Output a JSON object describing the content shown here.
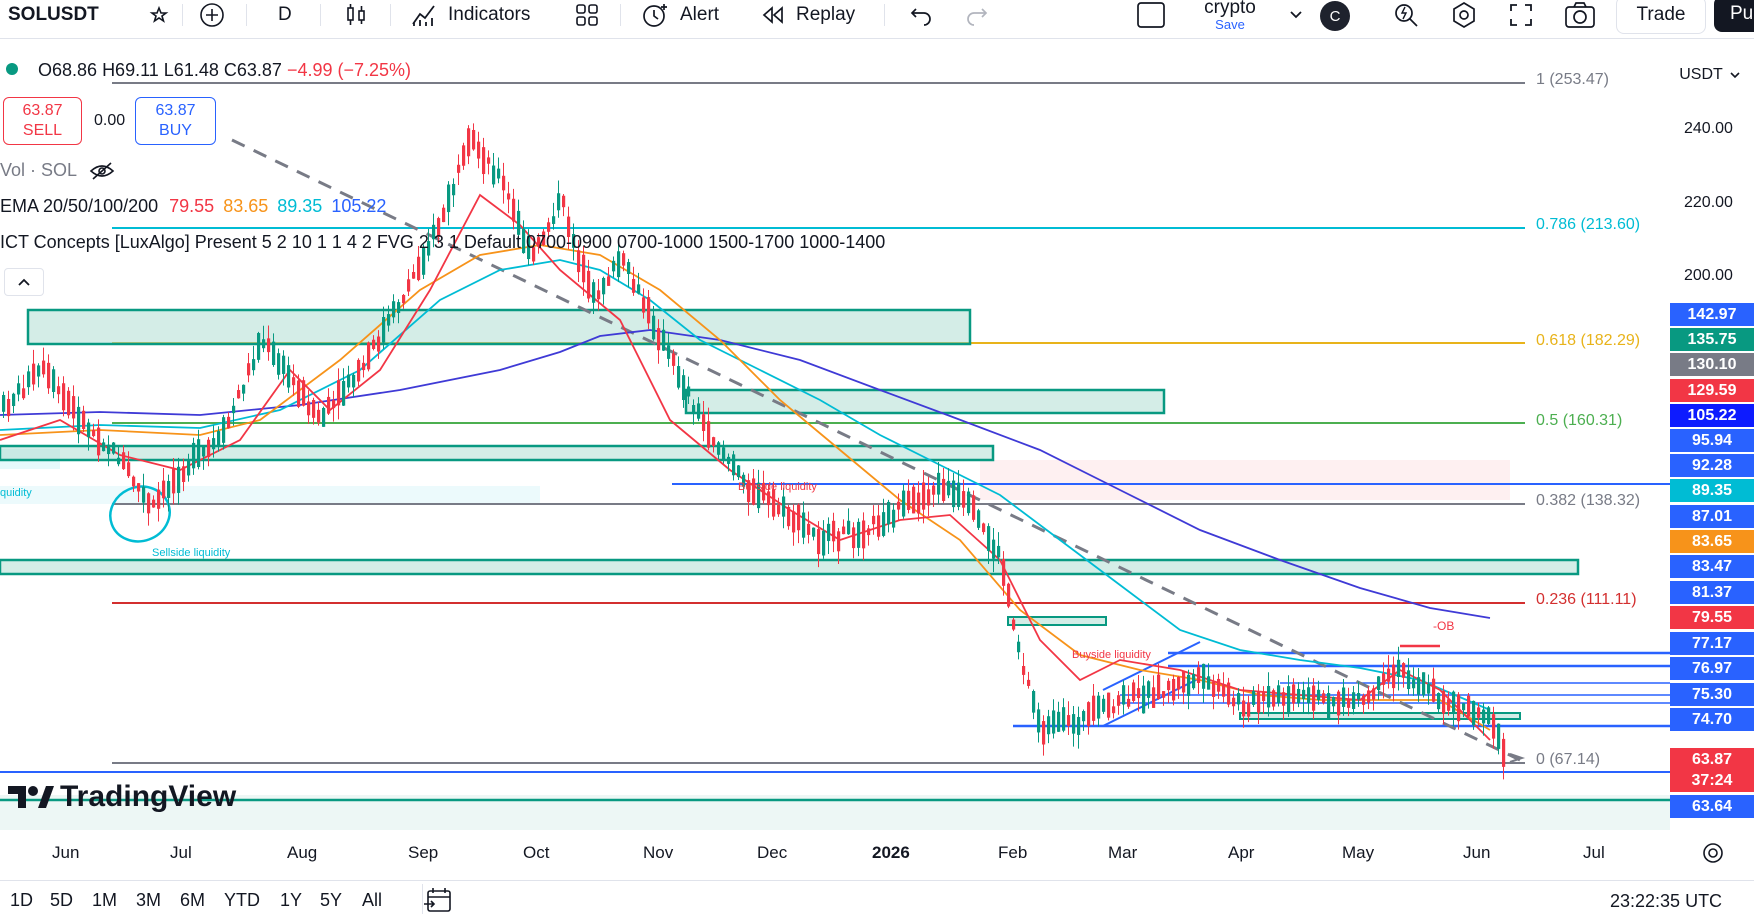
{
  "toolbar": {
    "symbol": "SOLUSDT",
    "interval": "D",
    "indicators_label": "Indicators",
    "alert_label": "Alert",
    "replay_label": "Replay",
    "layout_name": "crypto",
    "layout_save": "Save",
    "avatar_letter": "C",
    "trade_label": "Trade",
    "publish_label": "Pu"
  },
  "ohlc": {
    "o": "O68.86",
    "h": "H69.11",
    "l": "L61.48",
    "c": "C63.87",
    "change": "−4.99 (−7.25%)"
  },
  "trade": {
    "sell_price": "63.87",
    "sell_label": "SELL",
    "spread": "0.00",
    "buy_price": "63.87",
    "buy_label": "BUY"
  },
  "indicators": {
    "vol_label": "Vol · SOL",
    "ema_label": "EMA 20/50/100/200",
    "ema20": "79.55",
    "ema50": "83.65",
    "ema100": "89.35",
    "ema200": "105.22",
    "ict_label": "ICT Concepts [LuxAlgo] Present 5 2 10 1 1 4 2 FVG 2 3 1 Default 0700-0900 0700-1000 1500-1700 1000-1400"
  },
  "chart_annotations": {
    "buyside_liquidity": "Buyside liquidity",
    "sellside_liquidity": "Sellside liquidity",
    "liquidity_cut": "quidity",
    "ob_label": "-OB",
    "watermark": "TradingView"
  },
  "fib_levels": [
    {
      "label": "1 (253.47)",
      "color": "#787b86"
    },
    {
      "label": "0.786 (213.60)",
      "color": "#00bcd4"
    },
    {
      "label": "0.618 (182.29)",
      "color": "#e8b31a"
    },
    {
      "label": "0.5 (160.31)",
      "color": "#4caf50"
    },
    {
      "label": "0.382 (138.32)",
      "color": "#787b86"
    },
    {
      "label": "0.236 (111.11)",
      "color": "#d32f2f"
    },
    {
      "label": "0 (67.14)",
      "color": "#787b86"
    }
  ],
  "price_axis": {
    "currency": "USDT",
    "ticks": [
      "240.00",
      "220.00",
      "200.00"
    ],
    "labels": [
      {
        "text": "142.97",
        "bg": "#2962ff"
      },
      {
        "text": "135.75",
        "bg": "#089981"
      },
      {
        "text": "130.10",
        "bg": "#787b86"
      },
      {
        "text": "129.59",
        "bg": "#f23645"
      },
      {
        "text": "105.22",
        "bg": "#0d1bff"
      },
      {
        "text": "95.94",
        "bg": "#2962ff"
      },
      {
        "text": "92.28",
        "bg": "#2962ff"
      },
      {
        "text": "89.35",
        "bg": "#00bcd4"
      },
      {
        "text": "87.01",
        "bg": "#2962ff"
      },
      {
        "text": "83.65",
        "bg": "#f7931a"
      },
      {
        "text": "83.47",
        "bg": "#2962ff"
      },
      {
        "text": "81.37",
        "bg": "#2962ff"
      },
      {
        "text": "79.55",
        "bg": "#f23645"
      },
      {
        "text": "77.17",
        "bg": "#2962ff"
      },
      {
        "text": "76.97",
        "bg": "#2962ff"
      },
      {
        "text": "75.30",
        "bg": "#2962ff"
      },
      {
        "text": "74.70",
        "bg": "#2962ff"
      },
      {
        "text": "63.87",
        "bg": "#f23645"
      },
      {
        "text": "37:24",
        "bg": "#f23645"
      },
      {
        "text": "63.64",
        "bg": "#2962ff"
      }
    ]
  },
  "time_axis": [
    "Jun",
    "Jul",
    "Aug",
    "Sep",
    "Oct",
    "Nov",
    "Dec",
    "2026",
    "Feb",
    "Mar",
    "Apr",
    "May",
    "Jun",
    "Jul"
  ],
  "ranges": [
    "1D",
    "5D",
    "1M",
    "3M",
    "6M",
    "YTD",
    "1Y",
    "5Y",
    "All"
  ],
  "clock": "23:22:35 UTC",
  "colors": {
    "up": "#089981",
    "down": "#f23645",
    "ema20": "#f23645",
    "ema50": "#f7931a",
    "ema100": "#00bcd4",
    "ema200": "#3f3ad6"
  }
}
